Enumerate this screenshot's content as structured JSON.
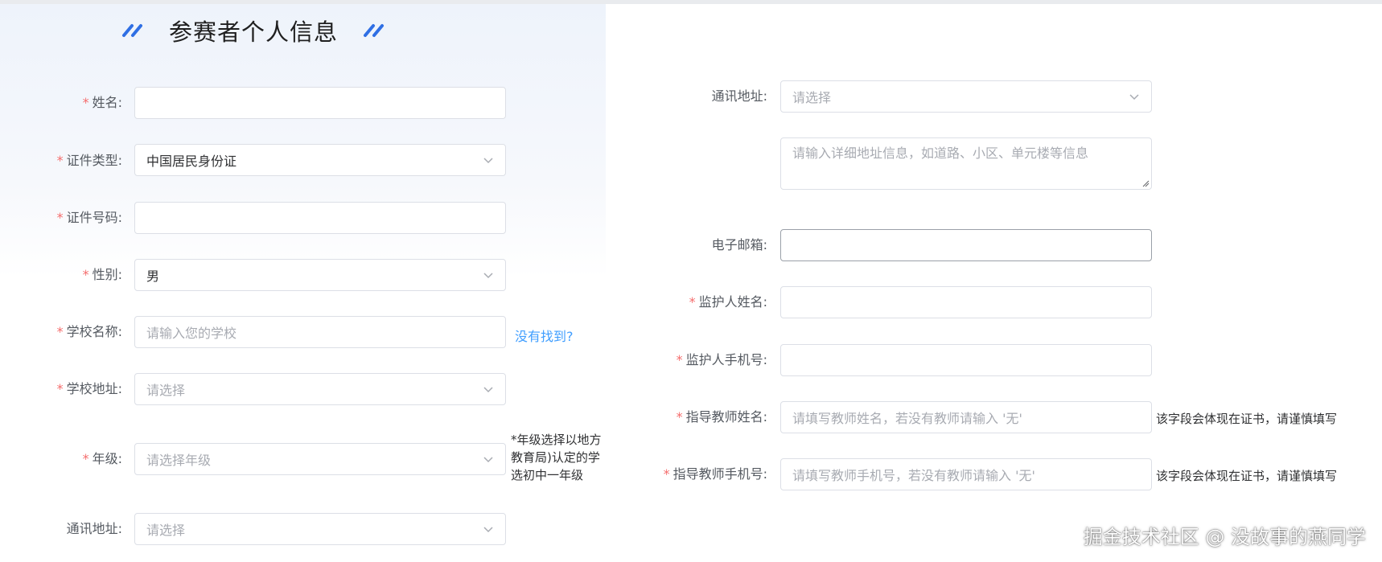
{
  "form": {
    "title": "参赛者个人信息",
    "required_mark": "*",
    "left": {
      "name": {
        "label": "姓名:",
        "value": ""
      },
      "id_type": {
        "label": "证件类型:",
        "value": "中国居民身份证"
      },
      "id_number": {
        "label": "证件号码:",
        "value": ""
      },
      "gender": {
        "label": "性别:",
        "value": "男"
      },
      "school_name": {
        "label": "学校名称:",
        "placeholder": "请输入您的学校",
        "not_found_link": "没有找到?"
      },
      "school_address": {
        "label": "学校地址:",
        "placeholder": "请选择"
      },
      "grade": {
        "label": "年级:",
        "placeholder": "请选择年级",
        "note_lines": [
          "*年级选择以地方",
          "教育局)认定的学",
          "选初中一年级"
        ]
      },
      "mailing_address": {
        "label": "通讯地址:",
        "placeholder": "请选择"
      }
    },
    "right": {
      "mailing_address": {
        "label": "通讯地址:",
        "placeholder": "请选择"
      },
      "address_detail": {
        "placeholder": "请输入详细地址信息，如道路、小区、单元楼等信息"
      },
      "email": {
        "label": "电子邮箱:",
        "value": ""
      },
      "guardian_name": {
        "label": "监护人姓名:",
        "value": ""
      },
      "guardian_phone": {
        "label": "监护人手机号:",
        "value": ""
      },
      "teacher_name": {
        "label": "指导教师姓名:",
        "placeholder": "请填写教师姓名，若没有教师请输入 '无'",
        "hint": "该字段会体现在证书，请谨慎填写"
      },
      "teacher_phone": {
        "label": "指导教师手机号:",
        "placeholder": "请填写教师手机号，若没有教师请输入 '无'",
        "hint": "该字段会体现在证书，请谨慎填写"
      }
    }
  },
  "watermark": "掘金技术社区 @ 没故事的燕同学",
  "icons": {
    "title_decoration": "double-slash-icon",
    "select_caret": "chevron-down-icon",
    "textarea_resize": "resize-handle-icon"
  },
  "colors": {
    "accent": "#2f6fe4",
    "required": "#f56c6c",
    "link": "#409eff",
    "placeholder": "#a8abb2",
    "border": "#dcdfe6"
  }
}
